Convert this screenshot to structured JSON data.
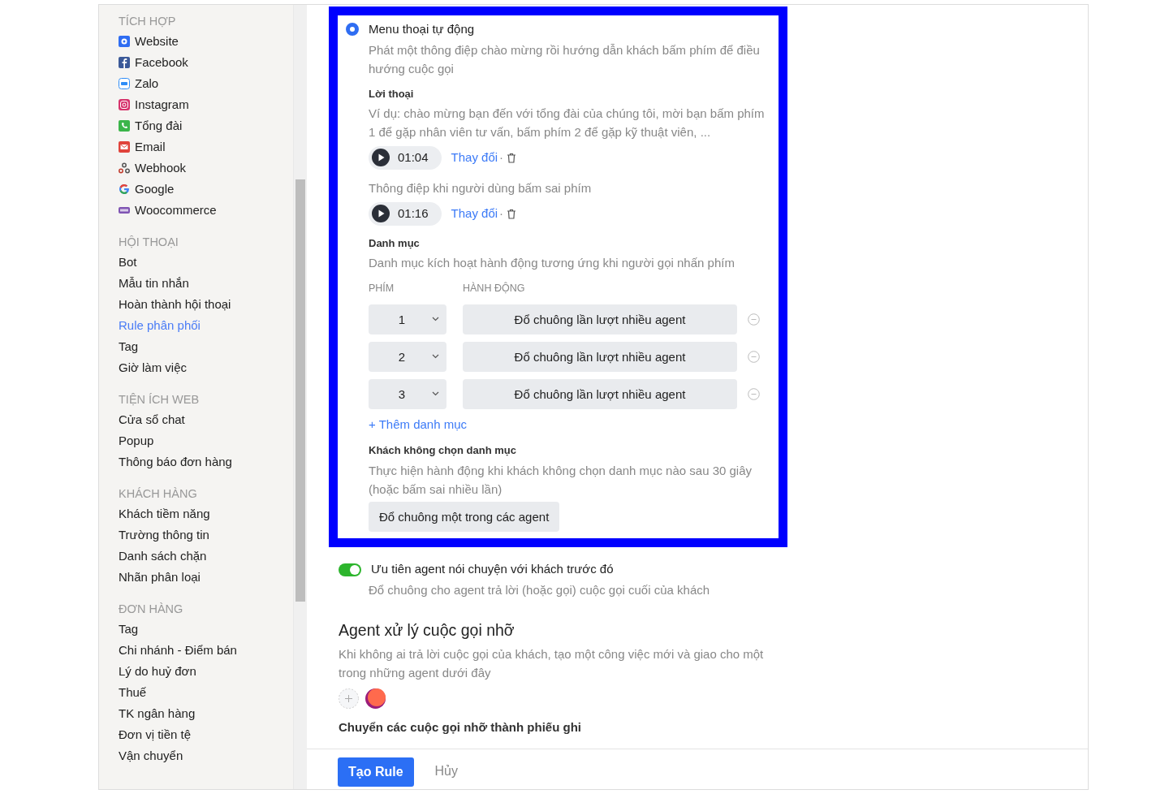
{
  "sidebar": {
    "sections": [
      {
        "title": "TÍCH HỢP",
        "items": [
          {
            "label": "Website",
            "selected": false
          },
          {
            "label": "Facebook",
            "selected": false
          },
          {
            "label": "Zalo",
            "selected": false
          },
          {
            "label": "Instagram",
            "selected": false
          },
          {
            "label": "Tổng đài",
            "selected": false
          },
          {
            "label": "Email",
            "selected": false
          },
          {
            "label": "Webhook",
            "selected": false
          },
          {
            "label": "Google",
            "selected": false
          },
          {
            "label": "Woocommerce",
            "selected": false
          }
        ]
      },
      {
        "title": "HỘI THOẠI",
        "items": [
          {
            "label": "Bot",
            "selected": false
          },
          {
            "label": "Mẫu tin nhắn",
            "selected": false
          },
          {
            "label": "Hoàn thành hội thoại",
            "selected": false
          },
          {
            "label": "Rule phân phối",
            "selected": true
          },
          {
            "label": "Tag",
            "selected": false
          },
          {
            "label": "Giờ làm việc",
            "selected": false
          }
        ]
      },
      {
        "title": "TIỆN ÍCH WEB",
        "items": [
          {
            "label": "Cửa sổ chat",
            "selected": false
          },
          {
            "label": "Popup",
            "selected": false
          },
          {
            "label": "Thông báo đơn hàng",
            "selected": false
          }
        ]
      },
      {
        "title": "KHÁCH HÀNG",
        "items": [
          {
            "label": "Khách tiềm năng",
            "selected": false
          },
          {
            "label": "Trường thông tin",
            "selected": false
          },
          {
            "label": "Danh sách chặn",
            "selected": false
          },
          {
            "label": "Nhãn phân loại",
            "selected": false
          }
        ]
      },
      {
        "title": "ĐƠN HÀNG",
        "items": [
          {
            "label": "Tag",
            "selected": false
          },
          {
            "label": "Chi nhánh - Điểm bán",
            "selected": false
          },
          {
            "label": "Lý do huỷ đơn",
            "selected": false
          },
          {
            "label": "Thuế",
            "selected": false
          },
          {
            "label": "TK ngân hàng",
            "selected": false
          },
          {
            "label": "Đơn vị tiền tệ",
            "selected": false
          },
          {
            "label": "Vận chuyển",
            "selected": false
          }
        ]
      }
    ]
  },
  "ivr_option": {
    "label": "Menu thoại tự động",
    "checked": true,
    "description": "Phát một thông điệp chào mừng rồi hướng dẫn khách bấm phím để điều hướng cuộc gọi",
    "greeting": {
      "title": "Lời thoại",
      "text": "Ví dụ: chào mừng bạn đến với tổng đài của chúng tôi, mời bạn bấm phím 1 để gặp nhân viên tư vấn, bấm phím 2 để gặp kỹ thuật viên, ...",
      "audio": {
        "duration": "01:04",
        "change": "Thay đổi",
        "separator": "·"
      }
    },
    "wrong_key": {
      "text": "Thông điệp khi người dùng bấm sai phím",
      "audio": {
        "duration": "01:16",
        "change": "Thay đổi",
        "separator": "·"
      }
    },
    "menu": {
      "title": "Danh mục",
      "description": "Danh mục kích hoạt hành động tương ứng khi người gọi nhấn phím",
      "columns": [
        "PHÍM",
        "HÀNH ĐỘNG"
      ],
      "rows": [
        {
          "key": "1",
          "action": "Đổ chuông lần lượt nhiều agent"
        },
        {
          "key": "2",
          "action": "Đổ chuông lần lượt nhiều agent"
        },
        {
          "key": "3",
          "action": "Đổ chuông lần lượt nhiều agent"
        }
      ],
      "add": "+ Thêm danh mục"
    },
    "no_choice": {
      "title": "Khách không chọn danh mục",
      "description": "Thực hiện hành động khi khách không chọn danh mục nào sau 30 giây (hoặc bấm sai nhiều lần)",
      "action": "Đổ chuông một trong các agent"
    }
  },
  "priority_toggle": {
    "on": true,
    "label": "Ưu tiên agent nói chuyện với khách trước đó",
    "description": "Đổ chuông cho agent trả lời (hoặc gọi) cuộc gọi cuối của khách"
  },
  "missed": {
    "title": "Agent xử lý cuộc gọi nhỡ",
    "description": "Khi không ai trả lời cuộc gọi của khách, tạo một công việc mới và giao cho một trong những agent dưới đây"
  },
  "convert_title": "Chuyển các cuộc gọi nhỡ thành phiếu ghi",
  "footer": {
    "buttons": [
      {
        "label": "Tạo Rule",
        "kind": "primary"
      },
      {
        "label": "Hủy",
        "kind": "link"
      }
    ]
  }
}
